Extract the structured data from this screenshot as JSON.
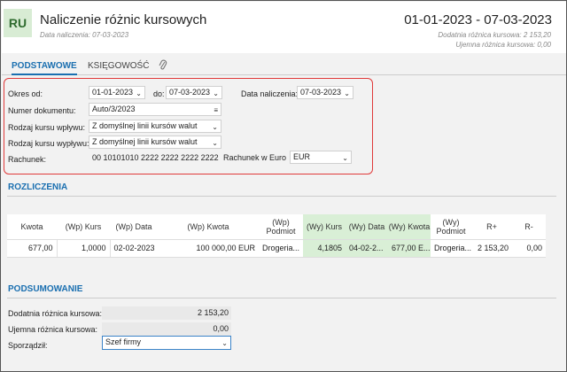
{
  "header": {
    "badge": "RU",
    "title": "Naliczenie różnic kursowych",
    "subtitle": "Data naliczenia: 07-03-2023",
    "range": "01-01-2023 - 07-03-2023",
    "positive_sum": "Dodatnia różnica kursowa: 2 153,20",
    "negative_sum": "Ujemna różnica kursowa: 0,00"
  },
  "tabs": [
    {
      "label": "PODSTAWOWE"
    },
    {
      "label": "KSIĘGOWOŚĆ"
    }
  ],
  "form": {
    "okres_label": "Okres od:",
    "okres_od": "01-01-2023",
    "do_label": "do:",
    "okres_do": "07-03-2023",
    "data_nal_label": "Data naliczenia:",
    "data_nal": "07-03-2023",
    "numer_label": "Numer dokumentu:",
    "numer": "Auto/3/2023",
    "kurs_wplywu_label": "Rodzaj kursu wpływu:",
    "kurs_wplywu": "Z domyślnej linii kursów walut",
    "kurs_wyplywu_label": "Rodzaj kursu wypływu:",
    "kurs_wyplywu": "Z domyślnej linii kursów walut",
    "rachunek_label": "Rachunek:",
    "rachunek": "00 10101010 2222 2222 2222 2222",
    "rachunek_name": "Rachunek w Euro",
    "waluta": "EUR"
  },
  "rozliczenia": {
    "title": "ROZLICZENIA",
    "columns": [
      "Kwota",
      "(Wp) Kurs",
      "(Wp) Data",
      "(Wp) Kwota",
      "(Wp) Podmiot",
      "(Wy) Kurs",
      "(Wy) Data",
      "(Wy) Kwota",
      "(Wy) Podmiot",
      "R+",
      "R-"
    ],
    "rows": [
      [
        "677,00",
        "1,0000",
        "02-02-2023",
        "100 000,00 EUR",
        "Drogeria...",
        "4,1805",
        "04-02-2...",
        "677,00 E...",
        "Drogeria...",
        "2 153,20",
        "0,00"
      ]
    ]
  },
  "podsumowanie": {
    "title": "PODSUMOWANIE",
    "dodatnia_label": "Dodatnia różnica kursowa:",
    "dodatnia": "2 153,20",
    "ujemna_label": "Ujemna różnica kursowa:",
    "ujemna": "0,00",
    "sporzadzil_label": "Sporządził:",
    "sporzadzil": "Szef firmy"
  },
  "colors": {
    "accent": "#1a6fb0",
    "highlight": "#e03a3a",
    "green": "#d9efd6"
  },
  "icons": [
    "paperclip-icon",
    "chevron-down-icon",
    "menu-icon"
  ]
}
